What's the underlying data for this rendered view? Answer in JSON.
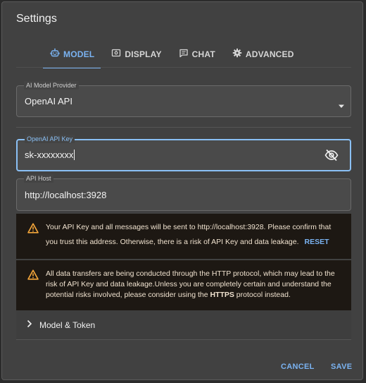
{
  "dialog": {
    "title": "Settings"
  },
  "tabs": [
    {
      "label": "MODEL",
      "icon": "robot-icon",
      "active": true
    },
    {
      "label": "DISPLAY",
      "icon": "display-icon",
      "active": false
    },
    {
      "label": "CHAT",
      "icon": "chat-icon",
      "active": false
    },
    {
      "label": "ADVANCED",
      "icon": "gear-icon",
      "active": false
    }
  ],
  "fields": {
    "provider": {
      "label": "AI Model Provider",
      "value": "OpenAI API"
    },
    "api_key": {
      "label": "OpenAI API Key",
      "value": "sk-xxxxxxxx"
    },
    "api_host": {
      "label": "API Host",
      "value": "http://localhost:3928"
    }
  },
  "alerts": {
    "host_warning": {
      "text": "Your API Key and all messages will be sent to http://localhost:3928. Please confirm that you trust this address. Otherwise, there is a risk of API Key and data leakage.",
      "action": "RESET"
    },
    "http_warning": {
      "text_before": "All data transfers are being conducted through the HTTP protocol, which may lead to the risk of API Key and data leakage.Unless you are completely certain and understand the potential risks involved, please consider using the ",
      "text_bold": "HTTPS",
      "text_after": " protocol instead."
    }
  },
  "accordion": {
    "label": "Model & Token"
  },
  "actions": {
    "cancel": "CANCEL",
    "save": "SAVE"
  },
  "colors": {
    "accent": "#7ab3f2",
    "dialog_bg": "#414141",
    "warning_bg": "#1d1813",
    "warning_icon": "#f4a63a"
  }
}
